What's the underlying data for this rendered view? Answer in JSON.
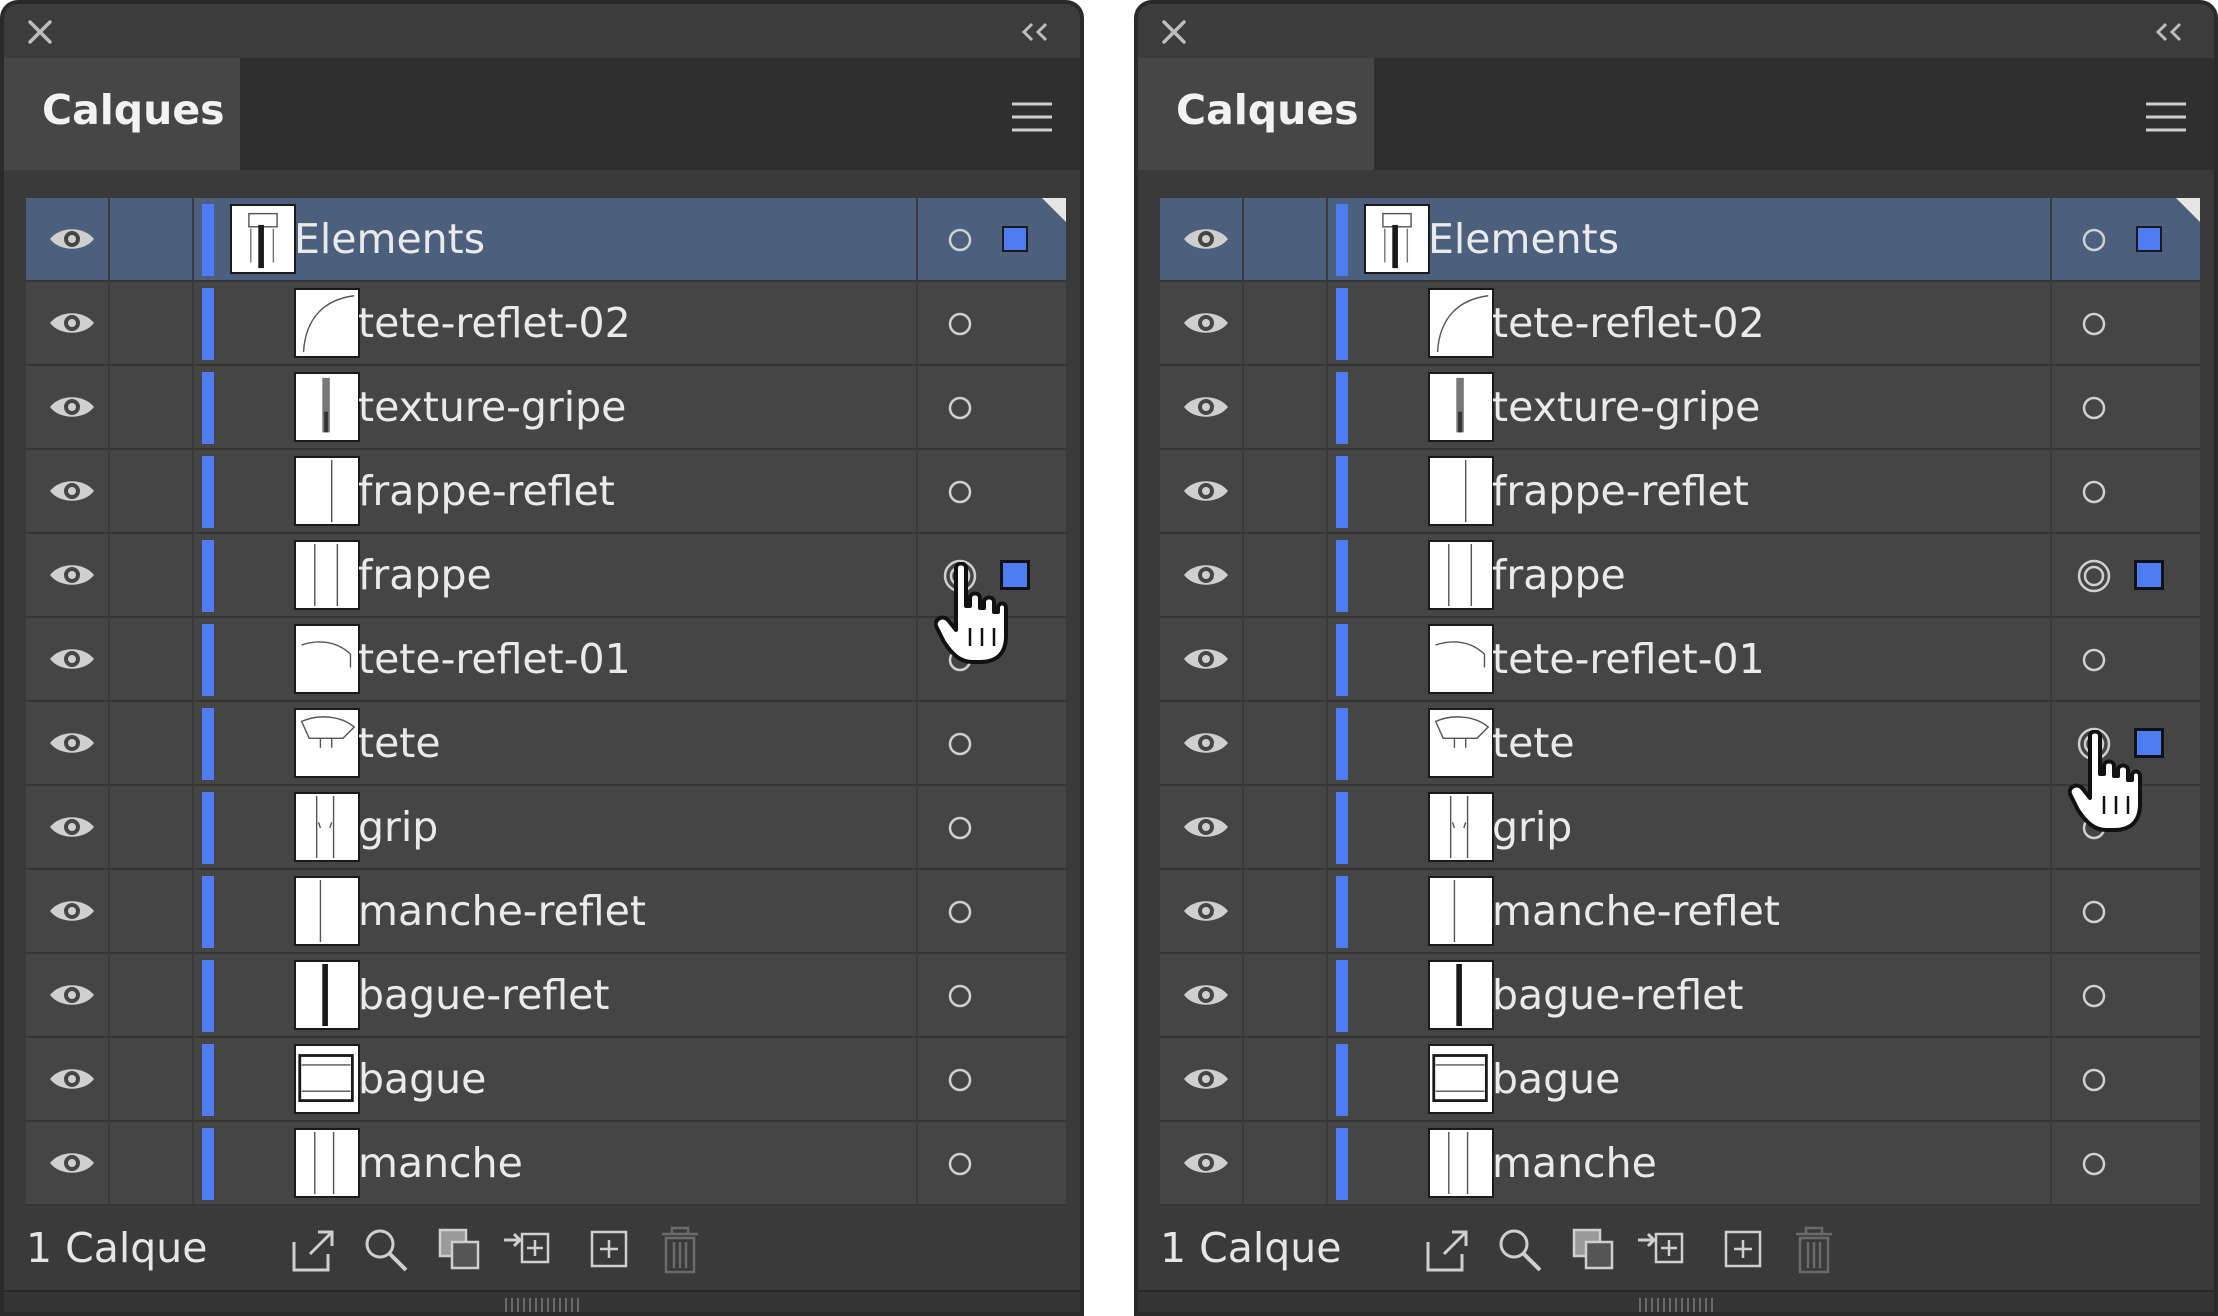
{
  "panels": [
    {
      "title": "Calques",
      "parent_layer": {
        "name": "Elements"
      },
      "sublayers": [
        {
          "name": "tete-reflet-02",
          "thumb": "curve",
          "selected": false,
          "targeted": false
        },
        {
          "name": "texture-gripe",
          "thumb": "texture",
          "selected": false,
          "targeted": false
        },
        {
          "name": "frappe-reflet",
          "thumb": "frappe-reflet",
          "selected": false,
          "targeted": false
        },
        {
          "name": "frappe",
          "thumb": "frappe",
          "selected": true,
          "targeted": true
        },
        {
          "name": "tete-reflet-01",
          "thumb": "tete-reflet",
          "selected": false,
          "targeted": false
        },
        {
          "name": "tete",
          "thumb": "tete",
          "selected": false,
          "targeted": false
        },
        {
          "name": "grip",
          "thumb": "grip",
          "selected": false,
          "targeted": false
        },
        {
          "name": "manche-reflet",
          "thumb": "manche-reflet",
          "selected": false,
          "targeted": false
        },
        {
          "name": "bague-reflet",
          "thumb": "bague-reflet",
          "selected": false,
          "targeted": false
        },
        {
          "name": "bague",
          "thumb": "bague",
          "selected": false,
          "targeted": false
        },
        {
          "name": "manche",
          "thumb": "manche",
          "selected": false,
          "targeted": false
        }
      ],
      "layer_count": "1 Calque",
      "cursor_on": "frappe"
    },
    {
      "title": "Calques",
      "parent_layer": {
        "name": "Elements"
      },
      "sublayers": [
        {
          "name": "tete-reflet-02",
          "thumb": "curve",
          "selected": false,
          "targeted": false
        },
        {
          "name": "texture-gripe",
          "thumb": "texture",
          "selected": false,
          "targeted": false
        },
        {
          "name": "frappe-reflet",
          "thumb": "frappe-reflet",
          "selected": false,
          "targeted": false
        },
        {
          "name": "frappe",
          "thumb": "frappe",
          "selected": true,
          "targeted": true
        },
        {
          "name": "tete-reflet-01",
          "thumb": "tete-reflet",
          "selected": false,
          "targeted": false
        },
        {
          "name": "tete",
          "thumb": "tete",
          "selected": true,
          "targeted": true
        },
        {
          "name": "grip",
          "thumb": "grip",
          "selected": false,
          "targeted": false
        },
        {
          "name": "manche-reflet",
          "thumb": "manche-reflet",
          "selected": false,
          "targeted": false
        },
        {
          "name": "bague-reflet",
          "thumb": "bague-reflet",
          "selected": false,
          "targeted": false
        },
        {
          "name": "bague",
          "thumb": "bague",
          "selected": false,
          "targeted": false
        },
        {
          "name": "manche",
          "thumb": "manche",
          "selected": false,
          "targeted": false
        }
      ],
      "layer_count": "1 Calque",
      "cursor_on": "tete"
    }
  ],
  "footer_icons": [
    "export-icon",
    "search-icon",
    "clipping-mask-icon",
    "collect-in-layer-icon",
    "new-sublayer-icon",
    "delete-icon"
  ],
  "colors": {
    "layer_color": "#4d7cf4",
    "selected_row": "#4c607e",
    "panel_bg": "#454545"
  }
}
